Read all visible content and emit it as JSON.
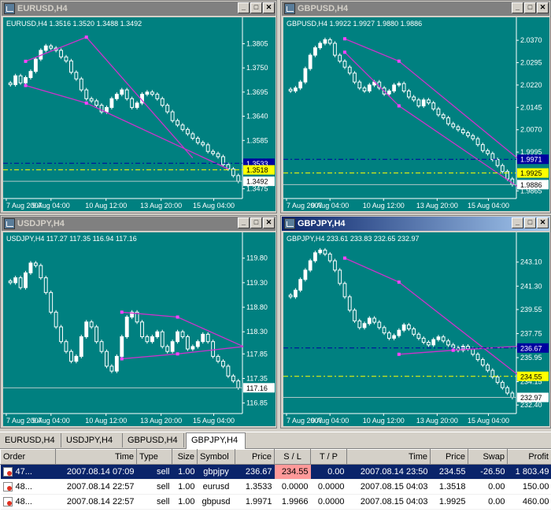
{
  "colors": {
    "chart_bg": "#008080",
    "candle_up": "#ffffff",
    "candle_down": "#ffffff",
    "trend_line": "#cc33cc",
    "bid_line": "#ffff00",
    "order_line": "#0000a0"
  },
  "window_buttons": {
    "minimize": "_",
    "maximize": "□",
    "close": "✕"
  },
  "windows": [
    {
      "title": "EURUSD,H4",
      "active": false,
      "info": "EURUSD,H4  1.3516 1.3520 1.3488 1.3492",
      "ticks": [
        "1.3805",
        "1.3750",
        "1.3695",
        "1.3640",
        "1.3585",
        "1.3475"
      ],
      "tags": [
        {
          "text": "1.3533",
          "type": "order"
        },
        {
          "text": "1.3518",
          "type": "bid"
        },
        {
          "text": "1.3492",
          "type": "price"
        }
      ],
      "xlabels": [
        "7 Aug 2007",
        "9 Aug 04:00",
        "10 Aug 12:00",
        "13 Aug 20:00",
        "15 Aug 04:00"
      ],
      "chart_data": {
        "type": "candlestick",
        "ylim": [
          1.346,
          1.384
        ],
        "ticks": [
          1.3805,
          1.375,
          1.3695,
          1.364,
          1.3585,
          1.3475
        ],
        "order_level": 1.3533,
        "bid_level": 1.3518,
        "close_level": 1.3492,
        "closes": [
          1.3712,
          1.3732,
          1.3716,
          1.3728,
          1.3742,
          1.377,
          1.379,
          1.38,
          1.3795,
          1.379,
          1.3775,
          1.3766,
          1.374,
          1.3725,
          1.37,
          1.368,
          1.3675,
          1.3665,
          1.365,
          1.366,
          1.368,
          1.369,
          1.37,
          1.368,
          1.366,
          1.367,
          1.369,
          1.3695,
          1.369,
          1.368,
          1.3665,
          1.365,
          1.363,
          1.362,
          1.361,
          1.36,
          1.359,
          1.358,
          1.3575,
          1.356,
          1.3555,
          1.3548,
          1.353,
          1.352,
          1.3505,
          1.3492
        ],
        "trendlines": [
          [
            [
              3,
              1.3765
            ],
            [
              15,
              1.382
            ],
            [
              36,
              1.3545
            ]
          ],
          [
            [
              3,
              1.371
            ],
            [
              15,
              1.367
            ],
            [
              43,
              1.352
            ]
          ]
        ]
      }
    },
    {
      "title": "GBPUSD,H4",
      "active": false,
      "info": "GBPUSD,H4  1.9922 1.9927 1.9880 1.9886",
      "ticks": [
        "2.0370",
        "2.0295",
        "2.0220",
        "2.0145",
        "2.0070",
        "1.9995",
        "1.9865"
      ],
      "tags": [
        {
          "text": "1.9971",
          "type": "order"
        },
        {
          "text": "1.9925",
          "type": "bid"
        },
        {
          "text": "1.9886",
          "type": "price"
        }
      ],
      "xlabels": [
        "7 Aug 2007",
        "9 Aug 04:00",
        "10 Aug 12:00",
        "13 Aug 20:00",
        "15 Aug 04:00"
      ],
      "chart_data": {
        "type": "candlestick",
        "ylim": [
          1.985,
          2.041
        ],
        "ticks": [
          2.037,
          2.0295,
          2.022,
          2.0145,
          2.007,
          1.9995,
          1.9865
        ],
        "order_level": 1.9971,
        "bid_level": 1.9925,
        "close_level": 1.9886,
        "closes": [
          2.02,
          2.021,
          2.023,
          2.0275,
          2.032,
          2.0345,
          2.036,
          2.0372,
          2.036,
          2.032,
          2.03,
          2.028,
          2.026,
          2.023,
          2.021,
          2.02,
          2.022,
          2.023,
          2.021,
          2.019,
          2.02,
          2.022,
          2.0225,
          2.02,
          2.018,
          2.017,
          2.015,
          2.017,
          2.016,
          2.014,
          2.012,
          2.011,
          2.009,
          2.008,
          2.007,
          2.006,
          2.005,
          2.004,
          2.002,
          2.0,
          1.999,
          1.997,
          1.995,
          1.993,
          1.9905,
          1.9886
        ],
        "trendlines": [
          [
            [
              11,
              2.0375
            ],
            [
              22,
              2.03
            ],
            [
              46,
              1.9975
            ]
          ],
          [
            [
              11,
              2.033
            ],
            [
              22,
              2.015
            ],
            [
              46,
              1.988
            ]
          ]
        ]
      }
    },
    {
      "title": "USDJPY,H4",
      "active": false,
      "info": "USDJPY,H4  117.27 117.35 116.94 117.16",
      "ticks": [
        "119.80",
        "119.30",
        "118.80",
        "118.30",
        "117.85",
        "117.35",
        "116.85"
      ],
      "tags": [
        {
          "text": "117.16",
          "type": "price"
        }
      ],
      "xlabels": [
        "7 Aug 2007",
        "9 Aug 04:00",
        "10 Aug 12:00",
        "13 Aug 20:00",
        "15 Aug 04:00"
      ],
      "chart_data": {
        "type": "candlestick",
        "ylim": [
          116.7,
          120.1
        ],
        "ticks": [
          119.8,
          119.3,
          118.8,
          118.3,
          117.85,
          117.35,
          116.85
        ],
        "close_level": 117.16,
        "closes": [
          119.3,
          119.4,
          119.2,
          119.5,
          119.7,
          119.65,
          119.4,
          119.1,
          118.7,
          118.4,
          118.1,
          117.9,
          117.7,
          117.8,
          118.2,
          118.5,
          118.4,
          118.1,
          117.9,
          117.6,
          117.5,
          117.8,
          118.2,
          118.6,
          118.7,
          118.5,
          118.2,
          118.1,
          118.2,
          118.3,
          118.0,
          117.9,
          118.1,
          118.3,
          118.2,
          117.95,
          118.0,
          118.1,
          118.25,
          118.1,
          117.8,
          117.7,
          117.6,
          117.4,
          117.3,
          117.16
        ],
        "trendlines": [
          [
            [
              22,
              118.7
            ],
            [
              33,
              118.6
            ],
            [
              46,
              118.0
            ]
          ],
          [
            [
              22,
              117.75
            ],
            [
              33,
              117.85
            ],
            [
              46,
              118.0
            ]
          ]
        ]
      }
    },
    {
      "title": "GBPJPY,H4",
      "active": true,
      "info": "GBPJPY,H4  233.61 233.83 232.65 232.97",
      "ticks": [
        "243.10",
        "241.30",
        "239.55",
        "237.75",
        "235.95",
        "234.15",
        "232.40"
      ],
      "tags": [
        {
          "text": "236.67",
          "type": "order"
        },
        {
          "text": "234.55",
          "type": "bid"
        },
        {
          "text": "232.97",
          "type": "price"
        }
      ],
      "xlabels": [
        "7 Aug 2007",
        "9 Aug 04:00",
        "10 Aug 12:00",
        "13 Aug 20:00",
        "15 Aug 04:00"
      ],
      "chart_data": {
        "type": "candlestick",
        "ylim": [
          232.0,
          244.5
        ],
        "ticks": [
          243.1,
          241.3,
          239.55,
          237.75,
          235.95,
          234.15,
          232.4
        ],
        "order_level": 236.67,
        "bid_level": 234.55,
        "close_level": 232.97,
        "closes": [
          240.5,
          241.0,
          241.8,
          242.5,
          243.2,
          243.8,
          244.0,
          243.7,
          243.2,
          242.5,
          241.5,
          240.5,
          239.5,
          238.7,
          238.2,
          238.5,
          238.9,
          238.6,
          238.2,
          237.8,
          237.4,
          237.6,
          238.0,
          238.4,
          238.1,
          237.7,
          237.4,
          237.1,
          236.9,
          237.3,
          237.5,
          237.2,
          236.9,
          236.7,
          236.5,
          236.8,
          236.6,
          236.2,
          235.8,
          235.4,
          235.0,
          234.5,
          234.1,
          233.7,
          233.3,
          232.97
        ],
        "trendlines": [
          [
            [
              11,
              243.4
            ],
            [
              22,
              241.6
            ],
            [
              46,
              234.7
            ]
          ],
          [
            [
              22,
              236.2
            ],
            [
              33,
              236.5
            ],
            [
              46,
              236.8
            ]
          ]
        ]
      }
    }
  ],
  "tabs": [
    "EURUSD,H4",
    "USDJPY,H4",
    "GBPUSD,H4",
    "GBPJPY,H4"
  ],
  "active_tab": 3,
  "orders": {
    "headers": [
      "Order",
      "Time",
      "Type",
      "Size",
      "Symbol",
      "Price",
      "S / L",
      "T / P",
      "Time",
      "Price",
      "Swap",
      "Profit"
    ],
    "rows": [
      {
        "order": "47...",
        "time": "2007.08.14 07:09",
        "type": "sell",
        "size": "1.00",
        "symbol": "gbpjpy",
        "price": "236.67",
        "sl": "234.55",
        "tp": "0.00",
        "time2": "2007.08.14 23:50",
        "price2": "234.55",
        "swap": "-26.50",
        "profit": "1 803.49",
        "selected": true
      },
      {
        "order": "48...",
        "time": "2007.08.14 22:57",
        "type": "sell",
        "size": "1.00",
        "symbol": "eurusd",
        "price": "1.3533",
        "sl": "0.0000",
        "tp": "0.0000",
        "time2": "2007.08.15 04:03",
        "price2": "1.3518",
        "swap": "0.00",
        "profit": "150.00",
        "selected": false
      },
      {
        "order": "48...",
        "time": "2007.08.14 22:57",
        "type": "sell",
        "size": "1.00",
        "symbol": "gbpusd",
        "price": "1.9971",
        "sl": "1.9966",
        "tp": "0.0000",
        "time2": "2007.08.15 04:03",
        "price2": "1.9925",
        "swap": "0.00",
        "profit": "460.00",
        "selected": false
      }
    ]
  }
}
